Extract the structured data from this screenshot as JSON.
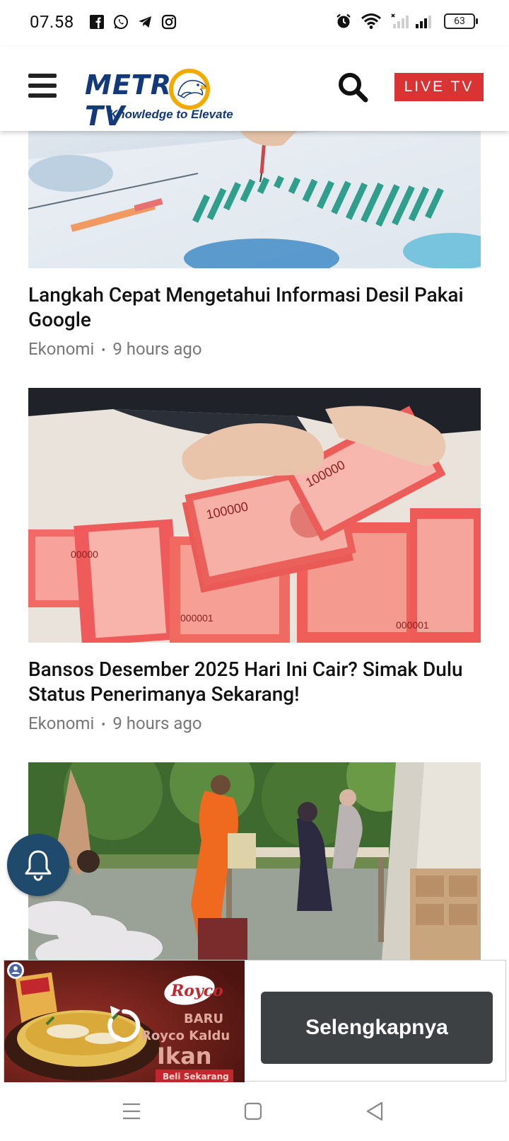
{
  "status_bar": {
    "time": "07.58",
    "battery": "63",
    "apps": [
      "facebook-icon",
      "whatsapp-icon",
      "telegram-icon",
      "instagram-icon"
    ],
    "indicators": [
      "alarm-icon",
      "wifi-icon",
      "signal-icon"
    ]
  },
  "header": {
    "logo_text": "METROTV",
    "logo_wordmark_left": "METR",
    "logo_wordmark_right": "TV",
    "tagline": "Knowledge to Elevate",
    "live_label": "LIVE TV"
  },
  "articles": [
    {
      "title": "Langkah Cepat Mengetahui Informasi Desil Pakai Google",
      "category": "Ekonomi",
      "separator": "•",
      "time": "9 hours ago"
    },
    {
      "title": "Bansos Desember 2025 Hari Ini Cair? Simak Dulu Status Penerimanya Sekarang!",
      "category": "Ekonomi",
      "separator": "•",
      "time": "9 hours ago"
    },
    {
      "title": "",
      "category": "",
      "time": ""
    }
  ],
  "ad": {
    "brand": "Royco",
    "headline_1": "BARU",
    "headline_2": "Royco Kaldu",
    "headline_3": "Ikan",
    "badge": "Beli Sekarang",
    "cta": "Selengkapnya"
  },
  "colors": {
    "accent_live": "#d93333",
    "brand_blue": "#123a7a",
    "bell_bg": "#1f4a6c",
    "cta_bg": "#3e4144"
  }
}
